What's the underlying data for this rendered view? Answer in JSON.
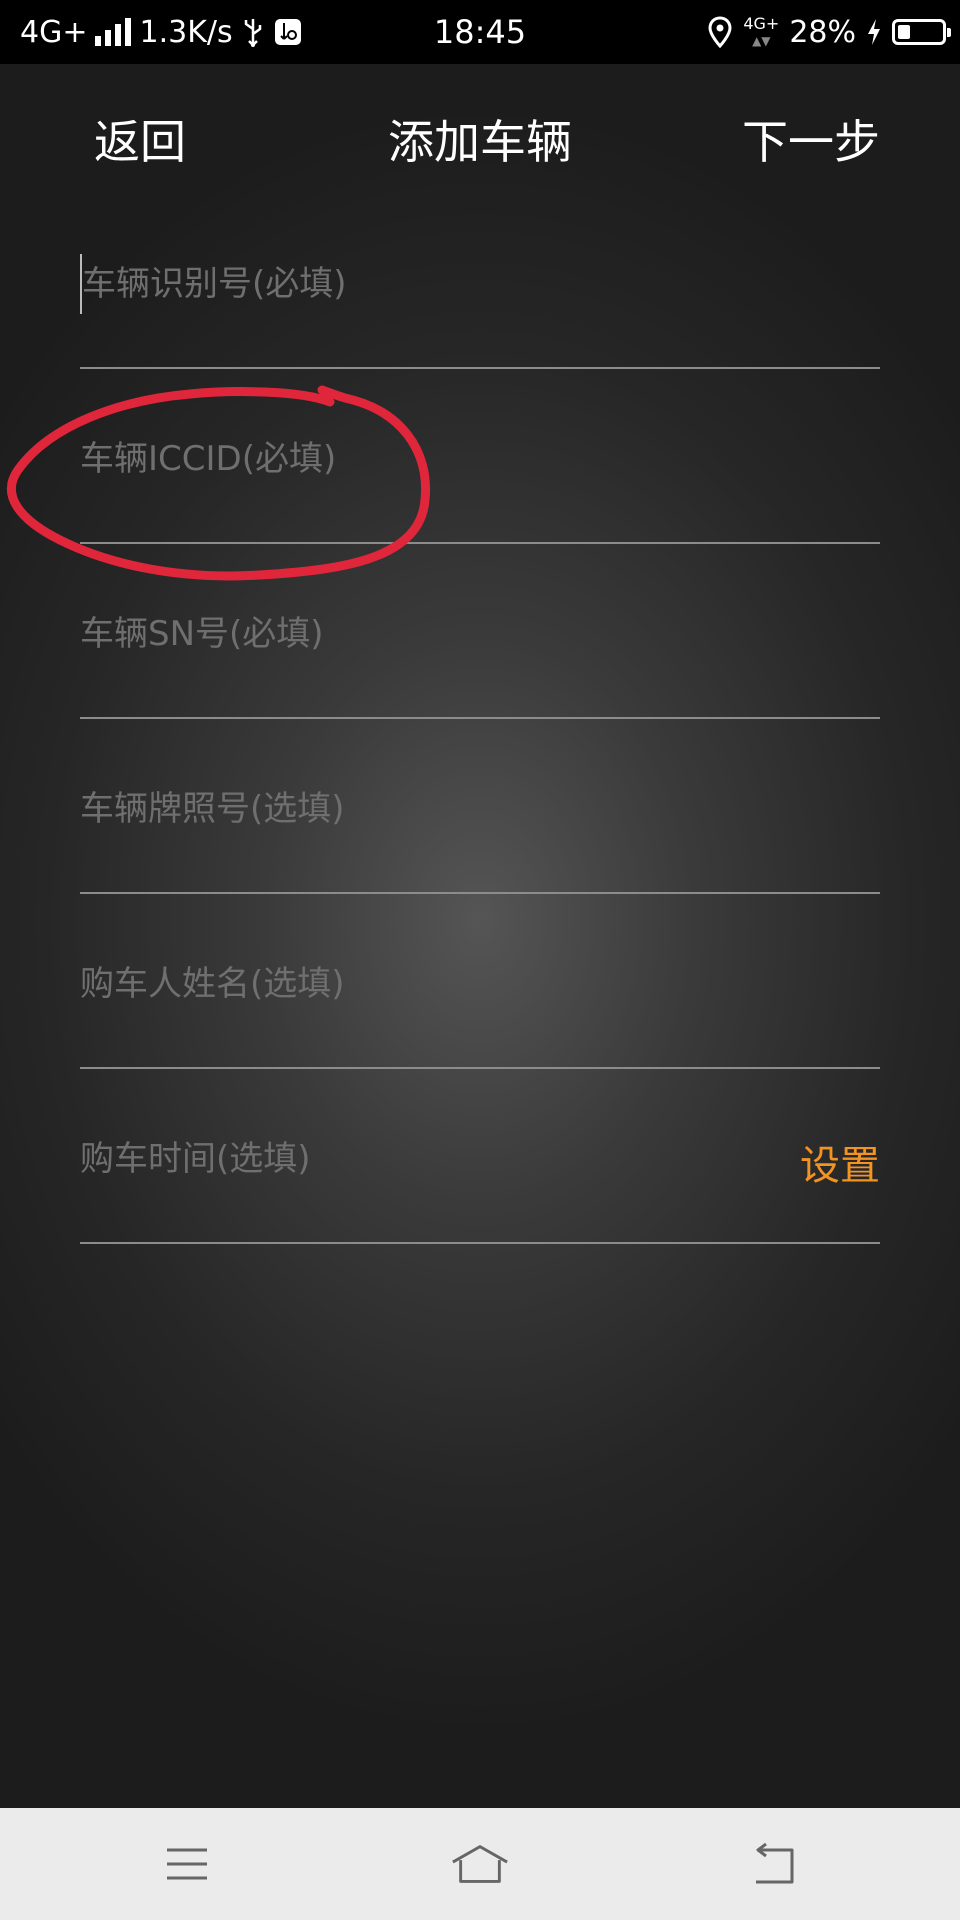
{
  "status_bar": {
    "network": "4G+",
    "speed": "1.3K/s",
    "time": "18:45",
    "secondary_network": "4G+",
    "battery_percent": "28%",
    "battery_level": 0.28
  },
  "header": {
    "back_label": "返回",
    "title": "添加车辆",
    "next_label": "下一步"
  },
  "form": {
    "fields": [
      {
        "placeholder": "车辆识别号(必填)",
        "value": ""
      },
      {
        "placeholder": "车辆ICCID(必填)",
        "value": ""
      },
      {
        "placeholder": "车辆SN号(必填)",
        "value": ""
      },
      {
        "placeholder": "车辆牌照号(选填)",
        "value": ""
      },
      {
        "placeholder": "购车人姓名(选填)",
        "value": ""
      },
      {
        "placeholder": "购车时间(选填)",
        "value": ""
      }
    ],
    "set_label": "设置"
  },
  "annotation": {
    "color": "#e0263a"
  },
  "colors": {
    "accent": "#f29322",
    "background": "#1c1c1c",
    "navbar": "#ebebeb"
  },
  "navbar": {
    "items": [
      {
        "icon": "menu-icon"
      },
      {
        "icon": "home-icon"
      },
      {
        "icon": "back-icon"
      }
    ]
  }
}
